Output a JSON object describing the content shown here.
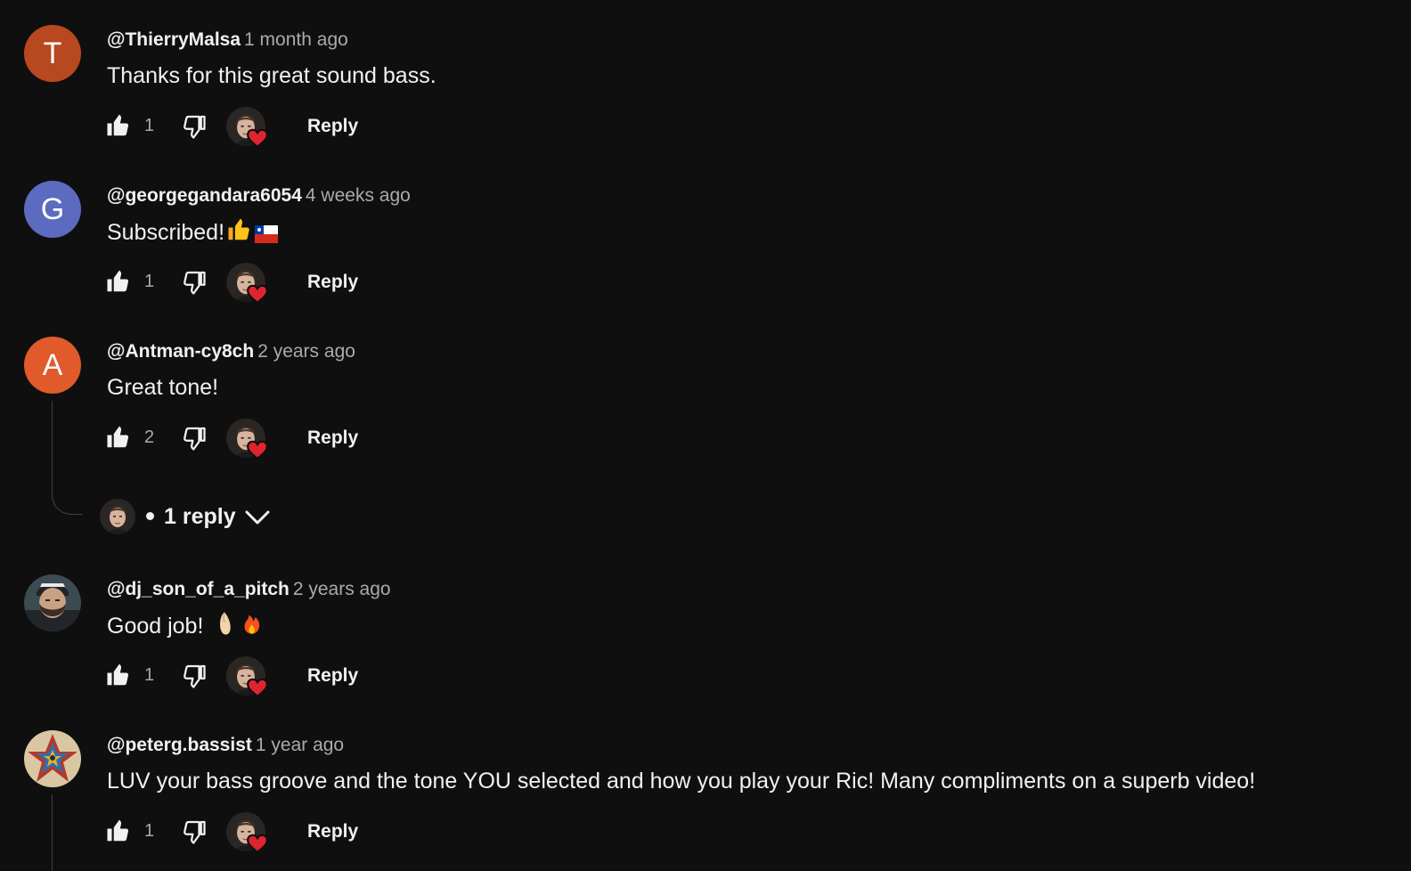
{
  "comments": [
    {
      "author": "@ThierryMalsa",
      "time": "1 month ago",
      "text": "Thanks for this great sound bass.",
      "likes": "1",
      "reply_label": "Reply",
      "avatar_letter": "T",
      "avatar_color": "#b8481f"
    },
    {
      "author": "@georgegandara6054",
      "time": "4 weeks ago",
      "text": "Subscribed!",
      "emojis": [
        "thumbs-up-emoji",
        "chile-flag-emoji"
      ],
      "likes": "1",
      "reply_label": "Reply",
      "avatar_letter": "G",
      "avatar_color": "#5c6bc0"
    },
    {
      "author": "@Antman-cy8ch",
      "time": "2 years ago",
      "text": "Great tone!",
      "likes": "2",
      "reply_label": "Reply",
      "avatar_letter": "A",
      "avatar_color": "#e05a2b",
      "replies_label": "1 reply"
    },
    {
      "author": "@dj_son_of_a_pitch",
      "time": "2 years ago",
      "text": "Good job! ",
      "emojis": [
        "pinched-fingers-emoji",
        "fire-emoji"
      ],
      "likes": "1",
      "reply_label": "Reply",
      "avatar_icon": "bearded-man-photo"
    },
    {
      "author": "@peterg.bassist",
      "time": "1 year ago",
      "text": "LUV your bass groove and the tone YOU selected and how you play your Ric!  Many compliments on a superb video!",
      "likes": "1",
      "reply_label": "Reply",
      "avatar_icon": "mosaic-pattern-photo"
    }
  ],
  "colors": {
    "background": "#0f0f0f",
    "text_primary": "#f1f1f1",
    "text_secondary": "#aaaaaa",
    "heart": "#e0242f"
  }
}
